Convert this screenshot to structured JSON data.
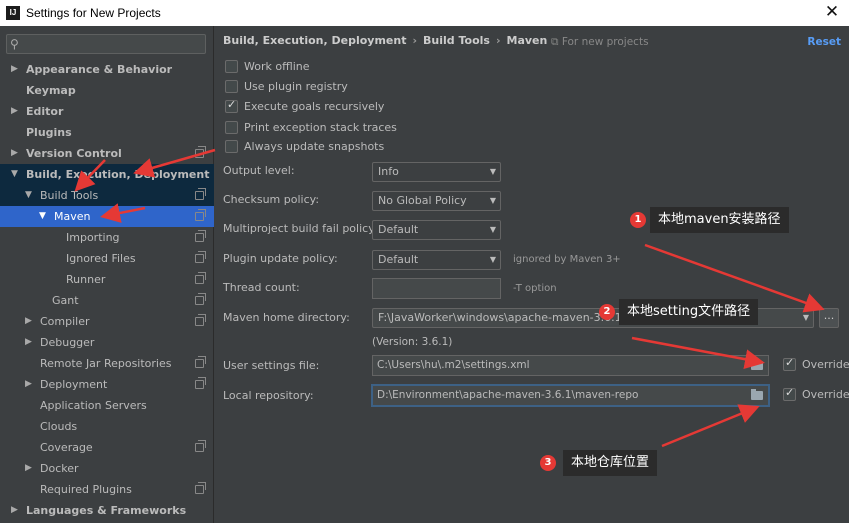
{
  "window": {
    "title": "Settings for New Projects",
    "app_icon": "IJ"
  },
  "search": {
    "placeholder": ""
  },
  "sidebar": {
    "items": [
      {
        "label": "Appearance & Behavior"
      },
      {
        "label": "Keymap"
      },
      {
        "label": "Editor"
      },
      {
        "label": "Plugins"
      },
      {
        "label": "Version Control"
      },
      {
        "label": "Build, Execution, Deployment"
      },
      {
        "label": "Build Tools"
      },
      {
        "label": "Maven"
      },
      {
        "label": "Importing"
      },
      {
        "label": "Ignored Files"
      },
      {
        "label": "Runner"
      },
      {
        "label": "Gant"
      },
      {
        "label": "Compiler"
      },
      {
        "label": "Debugger"
      },
      {
        "label": "Remote Jar Repositories"
      },
      {
        "label": "Deployment"
      },
      {
        "label": "Application Servers"
      },
      {
        "label": "Clouds"
      },
      {
        "label": "Coverage"
      },
      {
        "label": "Docker"
      },
      {
        "label": "Required Plugins"
      },
      {
        "label": "Languages & Frameworks"
      }
    ]
  },
  "breadcrumb": {
    "part1": "Build, Execution, Deployment",
    "part2": "Build Tools",
    "part3": "Maven",
    "sep": "›"
  },
  "header": {
    "for_new_projects": "For new projects",
    "reset": "Reset"
  },
  "checkboxes": [
    {
      "label": "Work offline",
      "checked": false
    },
    {
      "label": "Use plugin registry",
      "checked": false
    },
    {
      "label": "Execute goals recursively",
      "checked": true
    },
    {
      "label": "Print exception stack traces",
      "checked": false
    },
    {
      "label": "Always update snapshots",
      "checked": false
    }
  ],
  "form": {
    "output_level": {
      "label": "Output level:",
      "value": "Info"
    },
    "checksum_policy": {
      "label": "Checksum policy:",
      "value": "No Global Policy"
    },
    "fail_policy": {
      "label": "Multiproject build fail policy:",
      "value": "Default"
    },
    "plugin_update": {
      "label": "Plugin update policy:",
      "value": "Default",
      "hint": "ignored by Maven 3+"
    },
    "thread_count": {
      "label": "Thread count:",
      "value": "",
      "hint": "-T option"
    },
    "maven_home": {
      "label": "Maven home directory:",
      "value": "F:\\JavaWorker\\windows\\apache-maven-3.6.1",
      "version": "(Version: 3.6.1)",
      "browse": "..."
    },
    "user_settings": {
      "label": "User settings file:",
      "value": "C:\\Users\\hu\\.m2\\settings.xml",
      "override": "Override"
    },
    "local_repo": {
      "label": "Local repository:",
      "value": "D:\\Environment\\apache-maven-3.6.1\\maven-repo",
      "override": "Override"
    }
  },
  "callouts": [
    {
      "num": "1",
      "text": "本地maven安装路径"
    },
    {
      "num": "2",
      "text": "本地setting文件路径"
    },
    {
      "num": "3",
      "text": "本地仓库位置"
    }
  ],
  "colors": {
    "accent": "#589df6",
    "selection": "#2f65ca",
    "annotation": "#e53935"
  }
}
